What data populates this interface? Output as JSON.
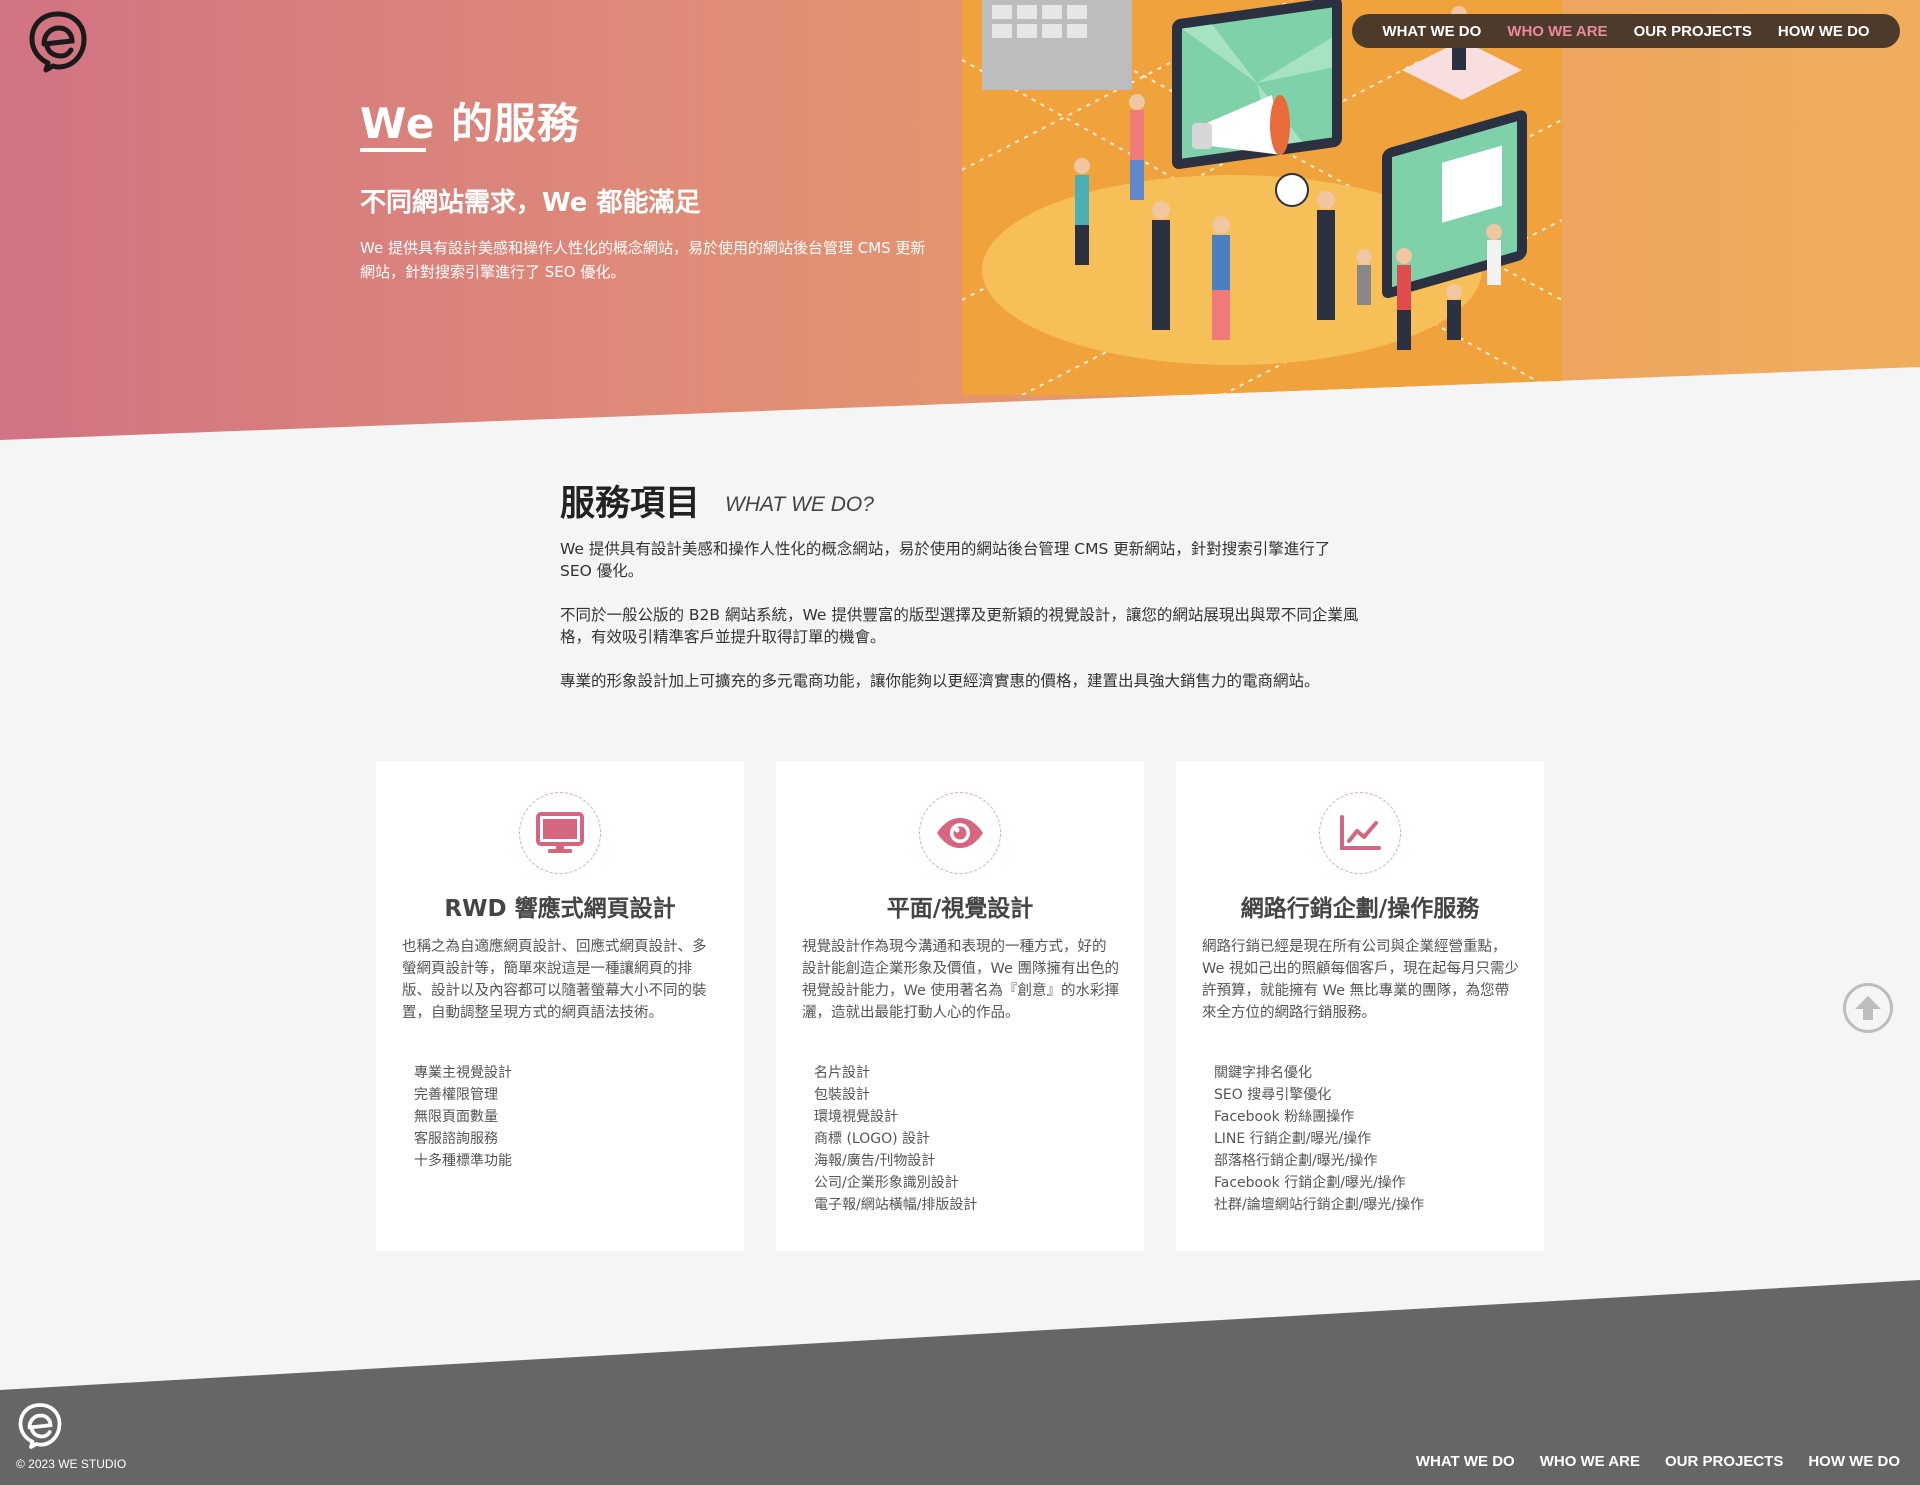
{
  "nav": {
    "items": [
      {
        "label": "WHAT WE DO",
        "active": false
      },
      {
        "label": "WHO WE ARE",
        "active": true
      },
      {
        "label": "OUR PROJECTS",
        "active": false
      },
      {
        "label": "HOW WE DO",
        "active": false
      }
    ]
  },
  "hero": {
    "title": "We 的服務",
    "subtitle": "不同網站需求，We 都能滿足",
    "description": "We 提供具有設計美感和操作人性化的概念網站，易於使用的網站後台管理 CMS 更新網站，針對搜索引擎進行了 SEO 優化。"
  },
  "services_intro": {
    "title": "服務項目",
    "title_en": "WHAT WE DO?",
    "paragraphs": [
      "We 提供具有設計美感和操作人性化的概念網站，易於使用的網站後台管理 CMS 更新網站，針對搜索引擎進行了 SEO 優化。",
      "不同於一般公版的 B2B 網站系統，We 提供豐富的版型選擇及更新穎的視覺設計，讓您的網站展現出與眾不同企業風格，有效吸引精準客戶並提升取得訂單的機會。",
      "專業的形象設計加上可擴充的多元電商功能，讓你能夠以更經濟實惠的價格，建置出具強大銷售力的電商網站。"
    ]
  },
  "cards": [
    {
      "icon": "monitor-icon",
      "title": "RWD 響應式網頁設計",
      "description": "也稱之為自適應網頁設計、回應式網頁設計、多螢網頁設計等，簡單來說這是一種讓網頁的排版、設計以及內容都可以隨著螢幕大小不同的裝置，自動調整呈現方式的網頁語法技術。",
      "items": [
        "專業主視覺設計",
        "完善權限管理",
        "無限頁面數量",
        "客服諮詢服務",
        "十多種標準功能"
      ]
    },
    {
      "icon": "eye-icon",
      "title": "平面/視覺設計",
      "description": "視覺設計作為現今溝通和表現的一種方式，好的設計能創造企業形象及價值，We 團隊擁有出色的視覺設計能力，We 使用著名為『創意』的水彩揮灑，造就出最能打動人心的作品。",
      "items": [
        "名片設計",
        "包裝設計",
        "環境視覺設計",
        "商標 (LOGO) 設計",
        "海報/廣告/刊物設計",
        "公司/企業形象識別設計",
        "電子報/網站橫幅/排版設計"
      ]
    },
    {
      "icon": "line-chart-icon",
      "title": "網路行銷企劃/操作服務",
      "description": "網路行銷已經是現在所有公司與企業經營重點，We 視如己出的照顧每個客戶，現在起每月只需少許預算，就能擁有 We 無比專業的團隊，為您帶來全方位的網路行銷服務。",
      "items": [
        "關鍵字排名優化",
        "SEO 搜尋引擎優化",
        "Facebook 粉絲團操作",
        "LINE 行銷企劃/曝光/操作",
        "部落格行銷企劃/曝光/操作",
        "Facebook 行銷企劃/曝光/操作",
        "社群/論壇網站行銷企劃/曝光/操作"
      ]
    }
  ],
  "footer": {
    "copyright": "© 2023 WE STUDIO",
    "nav": [
      "WHAT WE DO",
      "WHO WE ARE",
      "OUR PROJECTS",
      "HOW WE DO"
    ]
  },
  "colors": {
    "accent": "#d6667f",
    "nav_active": "#e88a9e",
    "nav_bg": "#4e3a2b",
    "footer_bg": "#666666",
    "hero_gradient_start": "#d17383",
    "hero_gradient_end": "#f0ae5d"
  }
}
